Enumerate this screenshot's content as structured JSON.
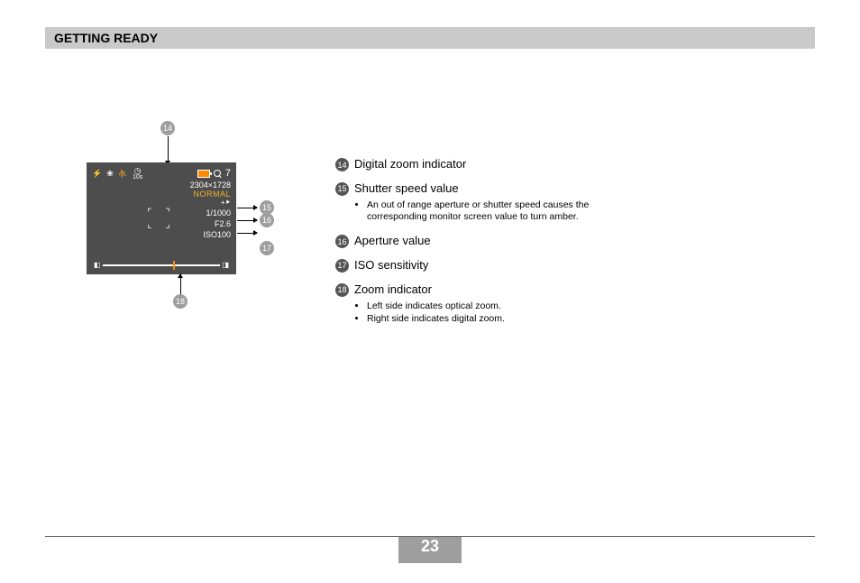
{
  "header": "GETTING READY",
  "lcd": {
    "tenS": "10s",
    "count": "7",
    "resolution": "2304×1728",
    "quality": "NORMAL",
    "arrow": "+⯈",
    "shutter": "1/1000",
    "aperture": "F2.6",
    "iso": "ISO100",
    "zoom_left": "◧",
    "zoom_right": "◨"
  },
  "callouts": {
    "c14": "14",
    "c15": "15",
    "c16": "16",
    "c17": "17",
    "c18": "18"
  },
  "legend": [
    {
      "num": "14",
      "title": "Digital zoom indicator",
      "notes": []
    },
    {
      "num": "15",
      "title": "Shutter speed value",
      "notes": [
        "An out of range aperture or shutter speed causes the corresponding monitor screen value to turn amber."
      ]
    },
    {
      "num": "16",
      "title": "Aperture value",
      "notes": []
    },
    {
      "num": "17",
      "title": "ISO sensitivity",
      "notes": []
    },
    {
      "num": "18",
      "title": "Zoom indicator",
      "notes": [
        "Left side indicates optical zoom.",
        "Right side indicates digital zoom."
      ]
    }
  ],
  "page_number": "23"
}
